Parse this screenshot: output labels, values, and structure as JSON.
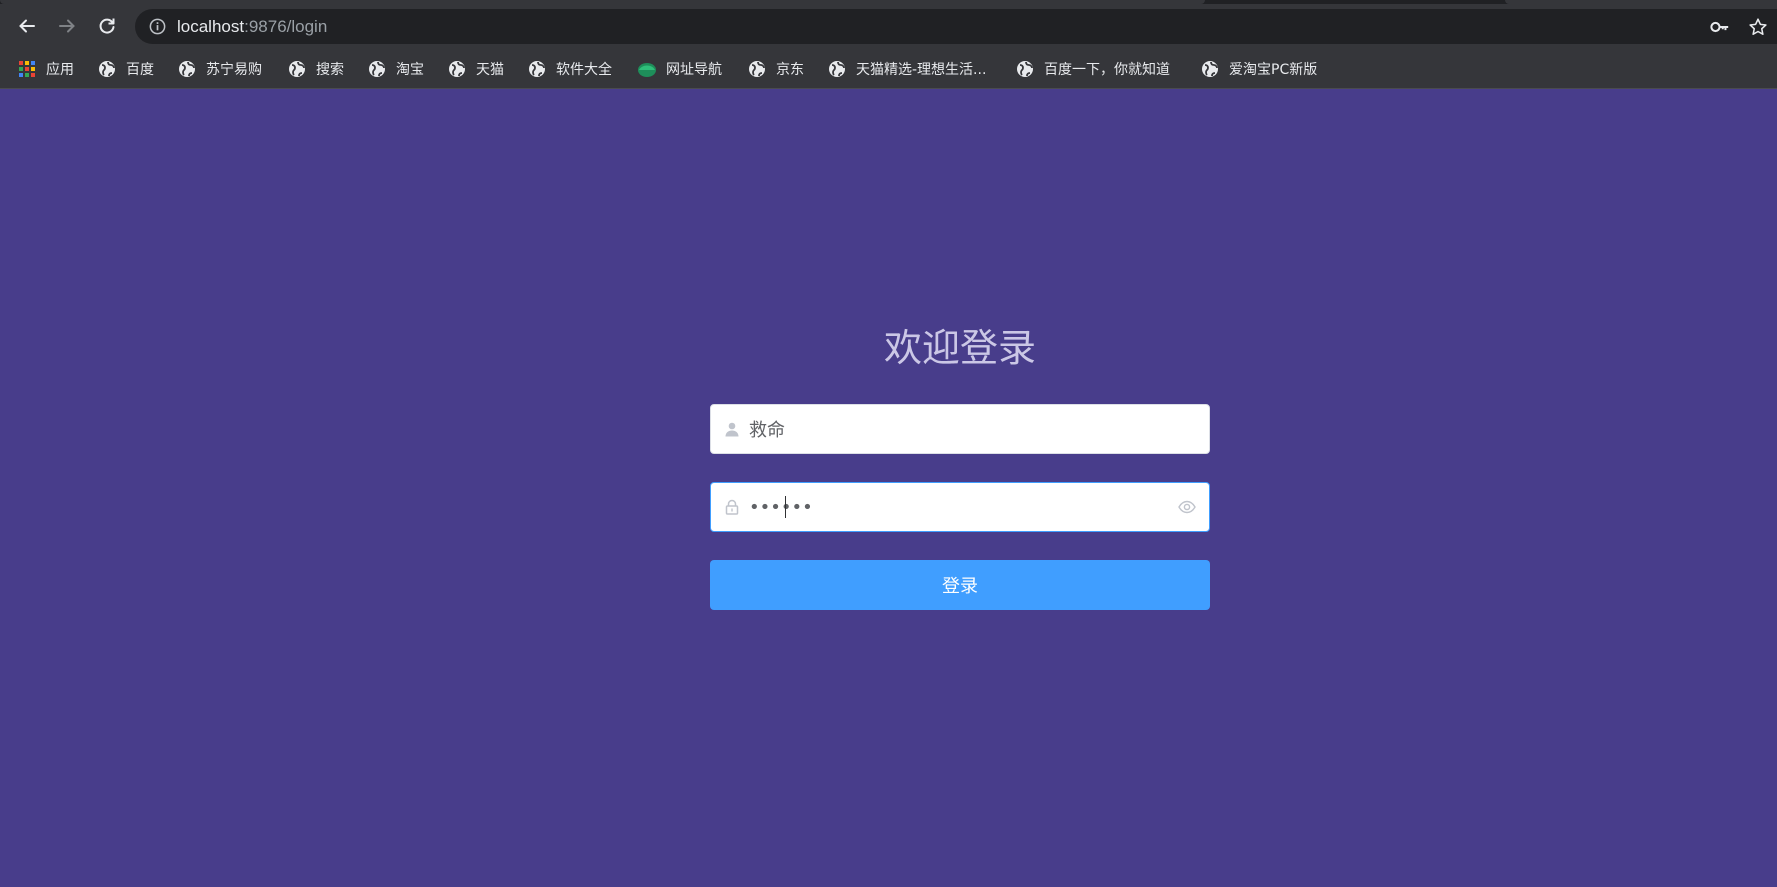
{
  "browser": {
    "url_host": "localhost",
    "url_rest": ":9876/login"
  },
  "bookmarks": [
    {
      "label": "应用",
      "icon": "apps-grid-icon"
    },
    {
      "label": "百度",
      "icon": "globe-icon"
    },
    {
      "label": "苏宁易购",
      "icon": "globe-icon"
    },
    {
      "label": "搜索",
      "icon": "globe-icon"
    },
    {
      "label": "淘宝",
      "icon": "globe-icon"
    },
    {
      "label": "天猫",
      "icon": "globe-icon"
    },
    {
      "label": "软件大全",
      "icon": "globe-icon"
    },
    {
      "label": "网址导航",
      "icon": "site-logo-icon"
    },
    {
      "label": "京东",
      "icon": "globe-icon"
    },
    {
      "label": "天猫精选-理想生活...",
      "icon": "globe-icon"
    },
    {
      "label": "百度一下，你就知道",
      "icon": "globe-icon"
    },
    {
      "label": "爱淘宝PC新版",
      "icon": "globe-icon"
    }
  ],
  "login": {
    "title": "欢迎登录",
    "username_value": "救命",
    "password_value": "••••••",
    "submit_label": "登录"
  },
  "colors": {
    "page_background": "#483d8b",
    "primary": "#409eff",
    "title_text": "#cbc7e6"
  }
}
